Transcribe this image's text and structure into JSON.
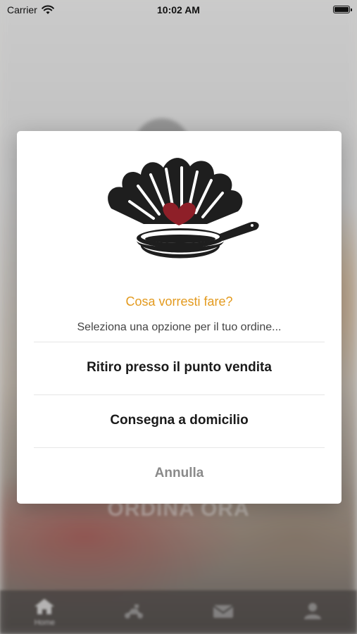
{
  "status_bar": {
    "carrier": "Carrier",
    "time": "10:02 AM",
    "wifi_icon": "wifi-icon",
    "battery_icon": "battery-icon"
  },
  "background": {
    "cta_label": "ORDINA ORA"
  },
  "tab_bar": {
    "tabs": [
      {
        "label": "Home",
        "icon": "home-icon",
        "active": true
      },
      {
        "label": "",
        "icon": "scooter-icon",
        "active": false
      },
      {
        "label": "",
        "icon": "mail-icon",
        "active": false
      },
      {
        "label": "",
        "icon": "user-icon",
        "active": false
      }
    ]
  },
  "dialog": {
    "logo_icon": "shell-pan-heart-logo",
    "title": "Cosa vorresti fare?",
    "subtitle": "Seleziona una opzione per il tuo ordine...",
    "options": [
      {
        "label": "Ritiro presso il punto vendita"
      },
      {
        "label": "Consegna a domicilio"
      }
    ],
    "cancel_label": "Annulla"
  },
  "colors": {
    "accent": "#e39a1e",
    "logo_dark": "#1e1e1e",
    "heart": "#8e1f28"
  }
}
